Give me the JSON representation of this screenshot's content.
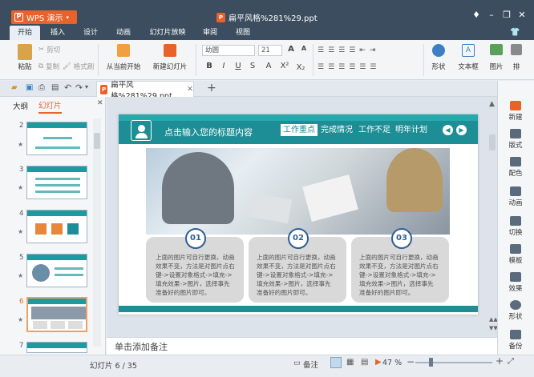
{
  "app": {
    "name": "WPS 演示",
    "doc_title": "扁平风格%281%29.ppt",
    "tab_label": "扁平风格%281%29.ppt"
  },
  "menu": [
    "开始",
    "插入",
    "设计",
    "动画",
    "幻灯片放映",
    "审阅",
    "视图"
  ],
  "ribbon": {
    "paste": "粘贴",
    "cut": "剪切",
    "copy": "复制",
    "format_painter": "格式刷",
    "from_current": "从当前开始",
    "new_slide": "新建幻灯片",
    "font_name": "幼圆",
    "font_size": "21",
    "shapes": "形状",
    "textbox": "文本框",
    "picture": "图片",
    "arrange": "排"
  },
  "left_panel": {
    "tab_outline": "大纲",
    "tab_slides": "幻灯片",
    "thumbs": [
      {
        "num": "2"
      },
      {
        "num": "3"
      },
      {
        "num": "4"
      },
      {
        "num": "5"
      },
      {
        "num": "6"
      },
      {
        "num": "7"
      }
    ],
    "selected": "6"
  },
  "slide": {
    "title": "点击输入您的标题内容",
    "nav": [
      "工作重点",
      "完成情况",
      "工作不足",
      "明年计划"
    ],
    "cards": [
      {
        "num": "01",
        "text": "上面的图片可自行更换，动画效果不变，方法是对图片点右键->设置对象格式->填充->填充效果->图片，选择事先准备好的图片即可。"
      },
      {
        "num": "02",
        "text": "上面的图片可自行更换，动画效果不变，方法是对图片点右键->设置对象格式->填充->填充效果->图片，选择事先准备好的图片即可。"
      },
      {
        "num": "03",
        "text": "上面的图片可自行更换，动画效果不变，方法是对图片点右键->设置对象格式->填充->填充效果->图片，选择事先准备好的图片即可。"
      }
    ]
  },
  "right_bar": [
    "新建",
    "版式",
    "配色",
    "动画",
    "切换",
    "模板",
    "效果",
    "形状",
    "备份"
  ],
  "notes_placeholder": "单击添加备注",
  "status": {
    "slide_counter": "幻灯片 6 / 35",
    "notes_btn": "备注",
    "zoom": "47 %"
  },
  "colors": {
    "accent": "#e8632b",
    "teal": "#1d8e95",
    "titlebar": "#3b4d5f",
    "badge": "#2f5f97"
  }
}
